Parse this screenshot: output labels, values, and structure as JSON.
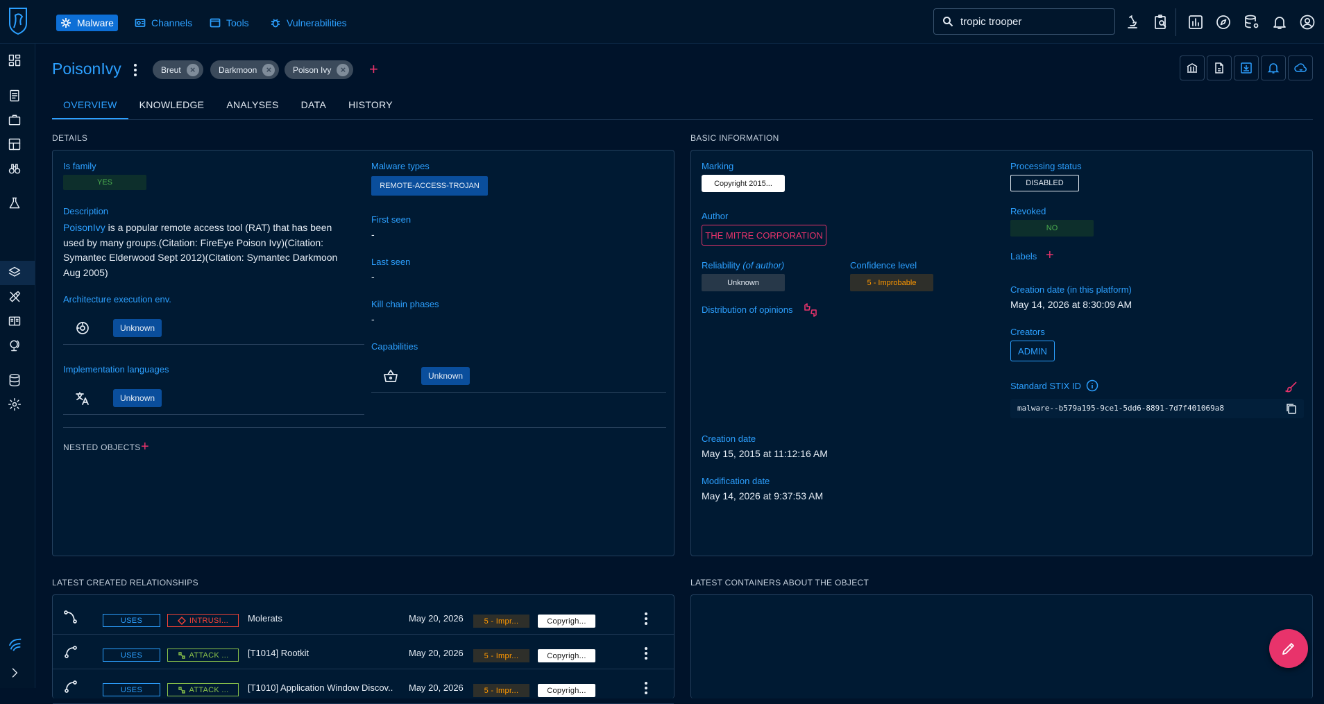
{
  "topnav": {
    "malware_label": "Malware",
    "channels_label": "Channels",
    "tools_label": "Tools",
    "vulnerabilities_label": "Vulnerabilities"
  },
  "search": {
    "value": "tropic trooper"
  },
  "entity": {
    "name": "PoisonIvy",
    "aliases": [
      "Breut",
      "Darkmoon",
      "Poison Ivy"
    ]
  },
  "tabs": [
    "OVERVIEW",
    "KNOWLEDGE",
    "ANALYSES",
    "DATA",
    "HISTORY"
  ],
  "details": {
    "section_title": "DETAILS",
    "is_family_label": "Is family",
    "is_family_value": "YES",
    "description_label": "Description",
    "description_link": "PoisonIvy",
    "description_rest_1": " is a popular remote access tool (RAT) that has been",
    "description_rest_2": "used by many groups.(Citation: FireEye Poison Ivy)(Citation:",
    "description_rest_3": "Symantec Elderwood Sept 2012)(Citation: Symantec Darkmoon",
    "description_rest_4": "Aug 2005)",
    "arch_label": "Architecture execution env.",
    "arch_value": "Unknown",
    "impl_label": "Implementation languages",
    "impl_value": "Unknown",
    "malware_types_label": "Malware types",
    "malware_types_value": "REMOTE-ACCESS-TROJAN",
    "first_seen_label": "First seen",
    "first_seen_value": "-",
    "last_seen_label": "Last seen",
    "last_seen_value": "-",
    "kill_chain_label": "Kill chain phases",
    "kill_chain_value": "-",
    "capabilities_label": "Capabilities",
    "capabilities_value": "Unknown",
    "nested_objects_label": "NESTED OBJECTS"
  },
  "basic": {
    "section_title": "BASIC INFORMATION",
    "marking_label": "Marking",
    "marking_value": "Copyright 2015...",
    "author_label": "Author",
    "author_value": "THE MITRE CORPORATION",
    "reliability_label": "Reliability",
    "reliability_suffix": "(of author)",
    "reliability_value": "Unknown",
    "confidence_label": "Confidence level",
    "confidence_value": "5 - Improbable",
    "opinions_label": "Distribution of opinions",
    "creation_date_label": "Creation date",
    "creation_date_value": "May 15, 2015 at 11:12:16 AM",
    "modification_date_label": "Modification date",
    "modification_date_value": "May 14, 2026 at 9:37:53 AM",
    "processing_label": "Processing status",
    "processing_value": "DISABLED",
    "revoked_label": "Revoked",
    "revoked_value": "NO",
    "labels_label": "Labels",
    "platform_date_label": "Creation date (in this platform)",
    "platform_date_value": "May 14, 2026 at 8:30:09 AM",
    "creators_label": "Creators",
    "creators_value": "ADMIN",
    "stix_label": "Standard STIX ID",
    "stix_value": "malware--b579a195-9ce1-5dd6-8891-7d7f401069a8"
  },
  "relationships": {
    "section_title": "LATEST CREATED RELATIONSHIPS",
    "rows": [
      {
        "rel": "USES",
        "type": "INTRUSI...",
        "type_color": "#f44336",
        "name": "Molerats",
        "date": "May 20, 2026",
        "confidence": "5 - Impr...",
        "marking": "Copyrigh..."
      },
      {
        "rel": "USES",
        "type": "ATTACK ...",
        "type_color": "#8bc34a",
        "name": "[T1014] Rootkit",
        "date": "May 20, 2026",
        "confidence": "5 - Impr...",
        "marking": "Copyrigh..."
      },
      {
        "rel": "USES",
        "type": "ATTACK ...",
        "type_color": "#8bc34a",
        "name": "[T1010] Application Window Discov...",
        "date": "May 20, 2026",
        "confidence": "5 - Impr...",
        "marking": "Copyrigh..."
      }
    ]
  },
  "containers": {
    "section_title": "LATEST CONTAINERS ABOUT THE OBJECT"
  },
  "colors": {
    "accent": "#2ca0ff",
    "brand_pink": "#e8336b",
    "background": "#00132a",
    "confidence_orange": "#ff9800"
  }
}
